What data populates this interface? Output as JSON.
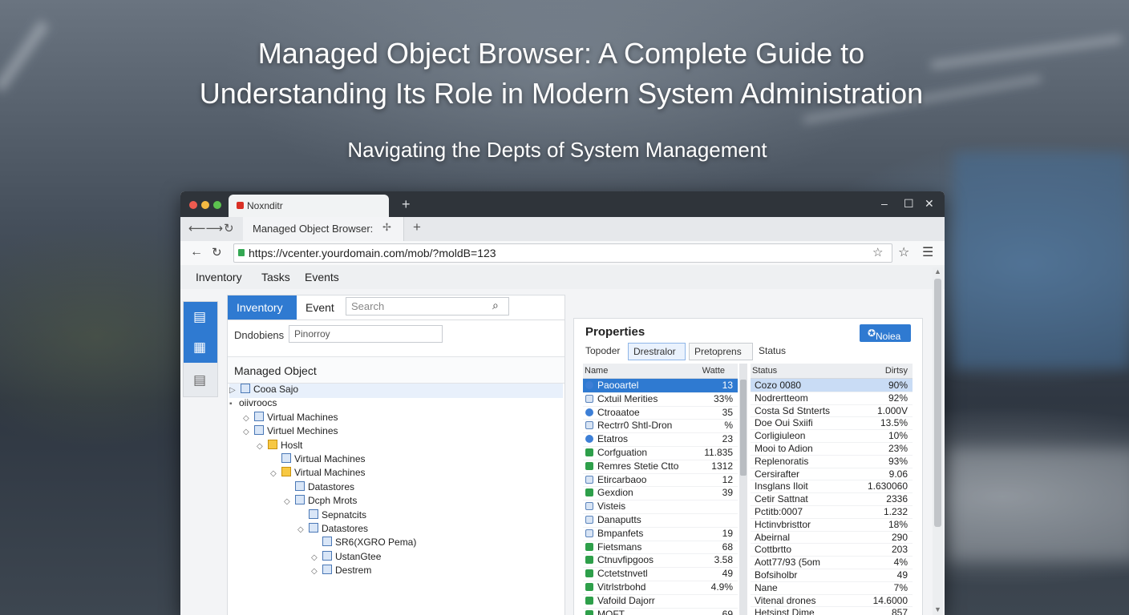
{
  "hero": {
    "title_line1": "Managed Object Browser: A Complete Guide to",
    "title_line2": "Understanding Its Role in Modern System Administration",
    "subtitle": "Navigating the Depts of System Management"
  },
  "browser": {
    "top_tab_label": "Noxnditr",
    "second_tab_label": "Managed Object Browser:",
    "url": "https://vcenter.yourdomain.com/mob/?moldB=123"
  },
  "app_menu": [
    "Inventory",
    "Tasks",
    "Events"
  ],
  "left_pane": {
    "tabs": [
      "Inventory",
      "Event"
    ],
    "search_placeholder": "Search",
    "filter_label": "Dndobiens",
    "filter_value": "Pinorroy",
    "header": "Managed Object",
    "tree": [
      {
        "label": "Cooa Sajo",
        "expander": "▷",
        "icon": "folder-icon",
        "depth": 0,
        "selected": true
      },
      {
        "label": "oiivroocs",
        "expander": "▪",
        "icon": "",
        "depth": 0,
        "selected": false
      },
      {
        "label": "Virtual Machines",
        "expander": "◇",
        "icon": "folder-icon",
        "depth": 1,
        "selected": false
      },
      {
        "label": "Virtuel Mechines",
        "expander": "◇",
        "icon": "folder-icon",
        "depth": 1,
        "selected": false
      },
      {
        "label": "Hoslt",
        "expander": "◇",
        "icon": "folder-yellow-icon",
        "depth": 2,
        "selected": false
      },
      {
        "label": "Virtual Machines",
        "expander": "",
        "icon": "folder-icon",
        "depth": 3,
        "selected": false
      },
      {
        "label": "Virtual Machines",
        "expander": "◇",
        "icon": "folder-yellow-icon",
        "depth": 3,
        "selected": false
      },
      {
        "label": "Datastores",
        "expander": "",
        "icon": "folder-icon",
        "depth": 4,
        "selected": false
      },
      {
        "label": "Dcph Mrots",
        "expander": "◇",
        "icon": "folder-icon",
        "depth": 4,
        "selected": false
      },
      {
        "label": "Sepnatcits",
        "expander": "",
        "icon": "folder-icon",
        "depth": 5,
        "selected": false
      },
      {
        "label": "Datastores",
        "expander": "◇",
        "icon": "folder-icon",
        "depth": 5,
        "selected": false
      },
      {
        "label": "SR6(XGRO Pema)",
        "expander": "",
        "icon": "folder-icon",
        "depth": 6,
        "selected": false
      },
      {
        "label": "UstanGtee",
        "expander": "◇",
        "icon": "folder-icon",
        "depth": 6,
        "selected": false
      },
      {
        "label": "Destrem",
        "expander": "◇",
        "icon": "folder-icon",
        "depth": 6,
        "selected": false
      }
    ]
  },
  "properties": {
    "title": "Properties",
    "note_button": "Noiea",
    "sub_tabs": [
      "Topoder",
      "Drestralor",
      "Pretoprens",
      "Status"
    ],
    "left_grid": {
      "col_name": "Name",
      "col_value": "Watte",
      "rows": [
        {
          "name": "Paooartel",
          "value": "13",
          "icon": "blue"
        },
        {
          "name": "Cxtuil Merities",
          "value": "33%",
          "icon": "box"
        },
        {
          "name": "Ctroaatoe",
          "value": "35",
          "icon": "blue"
        },
        {
          "name": "Rectrr0 Shtl-Dron",
          "value": "%",
          "icon": "box"
        },
        {
          "name": "Etatros",
          "value": "23",
          "icon": "blue"
        },
        {
          "name": "Corfguation",
          "value": "11.835",
          "icon": "green"
        },
        {
          "name": "Remres Stetie Ctto",
          "value": "1312",
          "icon": "green"
        },
        {
          "name": "Etircarbaoo",
          "value": "12",
          "icon": "box"
        },
        {
          "name": "Gexdion",
          "value": "39",
          "icon": "green"
        },
        {
          "name": "Visteis",
          "value": "",
          "icon": "box"
        },
        {
          "name": "Danaputts",
          "value": "",
          "icon": "box"
        },
        {
          "name": "Bmpanfets",
          "value": "19",
          "icon": "box"
        },
        {
          "name": "Fietsmans",
          "value": "68",
          "icon": "green"
        },
        {
          "name": "Ctnuvfipgoos",
          "value": "3.58",
          "icon": "green"
        },
        {
          "name": "Cctetstnvetl",
          "value": "49",
          "icon": "green"
        },
        {
          "name": "Vitrlstrbohd",
          "value": "4.9%",
          "icon": "green"
        },
        {
          "name": "Vafoild Dajorr",
          "value": "",
          "icon": "green"
        },
        {
          "name": "MOFT",
          "value": "69",
          "icon": "green"
        }
      ]
    },
    "right_grid": {
      "col_name": "Status",
      "col_value": "Dirtsy",
      "rows": [
        {
          "name": "Cozo 0080",
          "value": "90%"
        },
        {
          "name": "Nodrertteom",
          "value": "92%"
        },
        {
          "name": "Costa Sd Stnterts",
          "value": "1.000V"
        },
        {
          "name": "Doe Oui Sxiifi",
          "value": "13.5%"
        },
        {
          "name": "Corligiuleon",
          "value": "10%"
        },
        {
          "name": "Mooi to Adion",
          "value": "23%"
        },
        {
          "name": "Replenoratis",
          "value": "93%"
        },
        {
          "name": "Cersirafter",
          "value": "9.06"
        },
        {
          "name": "Insglans Iloit",
          "value": "1.630060"
        },
        {
          "name": "Cetir Sattnat",
          "value": "2336"
        },
        {
          "name": "Pctitb:0007",
          "value": "1.232"
        },
        {
          "name": "Hctinvbristtor",
          "value": "18%"
        },
        {
          "name": "Abeirnal",
          "value": "290"
        },
        {
          "name": "Cottbrtto",
          "value": "203"
        },
        {
          "name": "Aott77/93 (5om",
          "value": "4%"
        },
        {
          "name": "Bofsiholbr",
          "value": "49"
        },
        {
          "name": "Nane",
          "value": "7%"
        },
        {
          "name": "Vitenal drones",
          "value": "14.6000"
        },
        {
          "name": "Hetsinst Dime",
          "value": "857"
        }
      ]
    }
  },
  "colors": {
    "accent": "#2f7ad1",
    "titlebar": "#2f343a",
    "selection_light": "#c9dcf5"
  }
}
